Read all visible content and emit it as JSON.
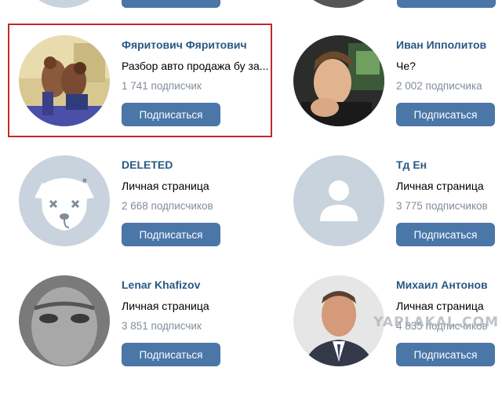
{
  "accent_color": "#4a76a8",
  "link_color": "#2a5885",
  "muted_color": "#818c99",
  "highlight_color": "#c0282a",
  "subscribe_label": "Подписаться",
  "watermark": "YAPLAKAL.COM",
  "cards": [
    {
      "name": "Фяритович Фяритович",
      "status": "Разбор авто продажа бу за...",
      "subscribers": "1 741 подписчик",
      "avatar": "wrestling-photo"
    },
    {
      "name": "Иван Ипполитов",
      "status": "Че?",
      "subscribers": "2 002 подписчика",
      "avatar": "young-man-photo"
    },
    {
      "name": "DELETED",
      "status": "Личная страница",
      "subscribers": "2 668 подписчиков",
      "avatar": "deleted-dog-icon"
    },
    {
      "name": "Тд Ен",
      "status": "Личная страница",
      "subscribers": "3 775 подписчиков",
      "avatar": "default-user-icon"
    },
    {
      "name": "Lenar Khafizov",
      "status": "Личная страница",
      "subscribers": "3 851 подписчик",
      "avatar": "grey-face-photo"
    },
    {
      "name": "Михаил Антонов",
      "status": "Личная страница",
      "subscribers": "4 835 подписчиков",
      "avatar": "man-suit-photo"
    }
  ]
}
